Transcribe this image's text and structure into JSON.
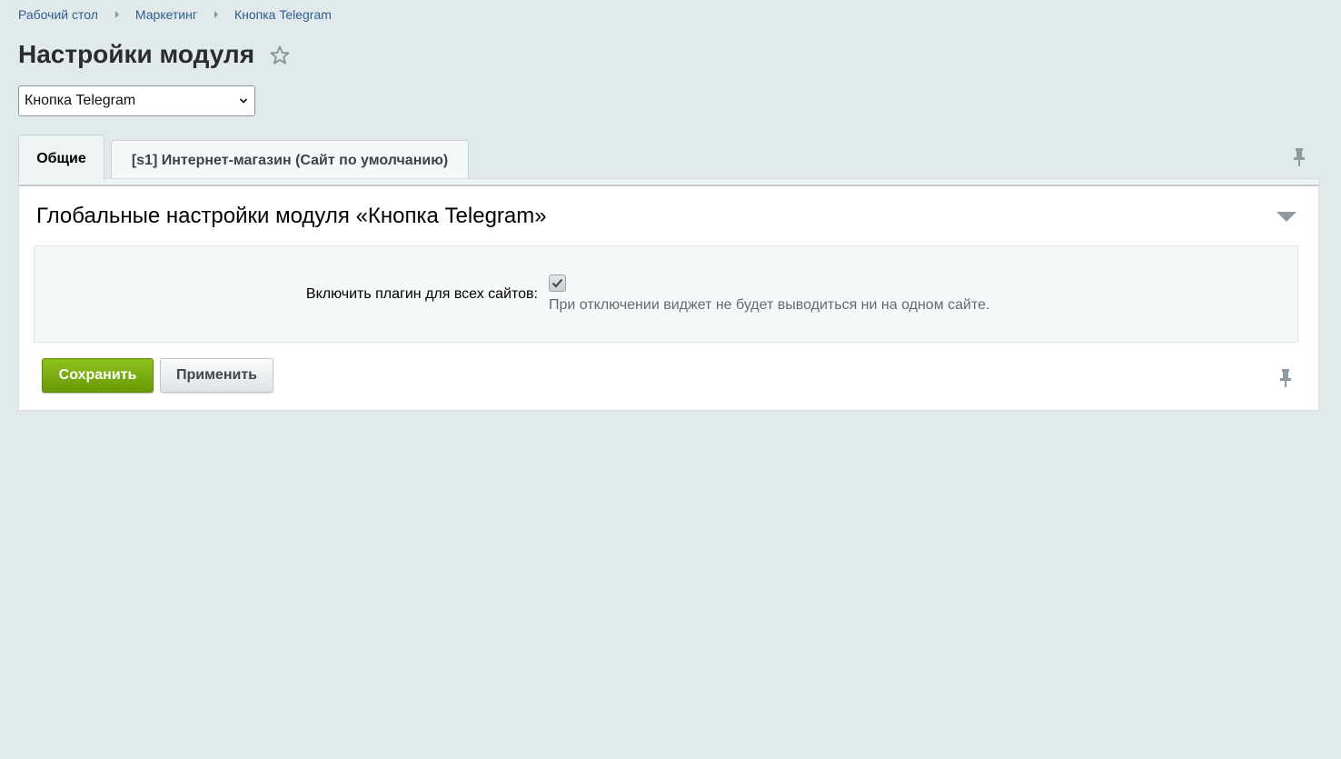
{
  "breadcrumb": {
    "items": [
      {
        "label": "Рабочий стол"
      },
      {
        "label": "Маркетинг"
      },
      {
        "label": "Кнопка Telegram"
      }
    ]
  },
  "header": {
    "title": "Настройки модуля",
    "favorite_icon": "star-icon"
  },
  "module_select": {
    "selected": "Кнопка Telegram"
  },
  "tabs": [
    {
      "label": "Общие",
      "active": true
    },
    {
      "label": "[s1] Интернет-магазин (Сайт по умолчанию)",
      "active": false
    }
  ],
  "section": {
    "title": "Глобальные настройки модуля «Кнопка Telegram»",
    "fields": [
      {
        "label": "Включить плагин для всех сайтов:",
        "checked": true,
        "hint": "При отключении виджет не будет выводиться ни на одном сайте."
      }
    ]
  },
  "buttons": {
    "save_label": "Сохранить",
    "apply_label": "Применить"
  },
  "colors": {
    "background": "#e2e9ea",
    "link": "#2d5f8b",
    "save_button": "#7aab0f"
  }
}
